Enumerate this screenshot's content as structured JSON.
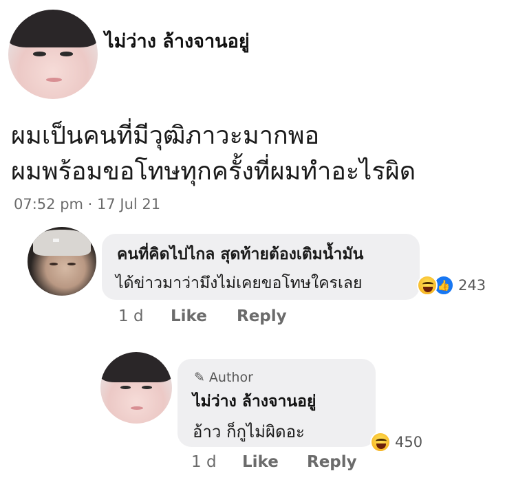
{
  "post": {
    "author": "ไม่ว่าง ล้างจานอยู่",
    "lines": [
      "ผมเป็นคนที่มีวุฒิภาวะมากพอ",
      "ผมพร้อมขอโทษทุกครั้งที่ผมทำอะไรผิด"
    ],
    "time": "07:52 pm · 17 Jul 21"
  },
  "comment": {
    "line1": "คนที่คิดไปไกล สุดท้ายต้องเติมน้ำมัน",
    "line2": "ได้ข่าวมาว่ามึงไม่เคยขอโทษใครเลย",
    "age": "1 d",
    "like": "Like",
    "reply": "Reply",
    "reactions": {
      "icons": [
        "haha-icon",
        "like-icon"
      ],
      "count": "243"
    }
  },
  "reply": {
    "badge": "Author",
    "name": "ไม่ว่าง ล้างจานอยู่",
    "text": "อ้าว ก็กูไม่ผิดอะ",
    "age": "1 d",
    "like": "Like",
    "reply": "Reply",
    "reactions": {
      "icons": [
        "haha-icon"
      ],
      "count": "450"
    }
  },
  "colors": {
    "bubble": "#efeff1",
    "meta": "#6b6b6b",
    "like_blue": "#1877f2",
    "haha_yellow": "#f7b928"
  }
}
